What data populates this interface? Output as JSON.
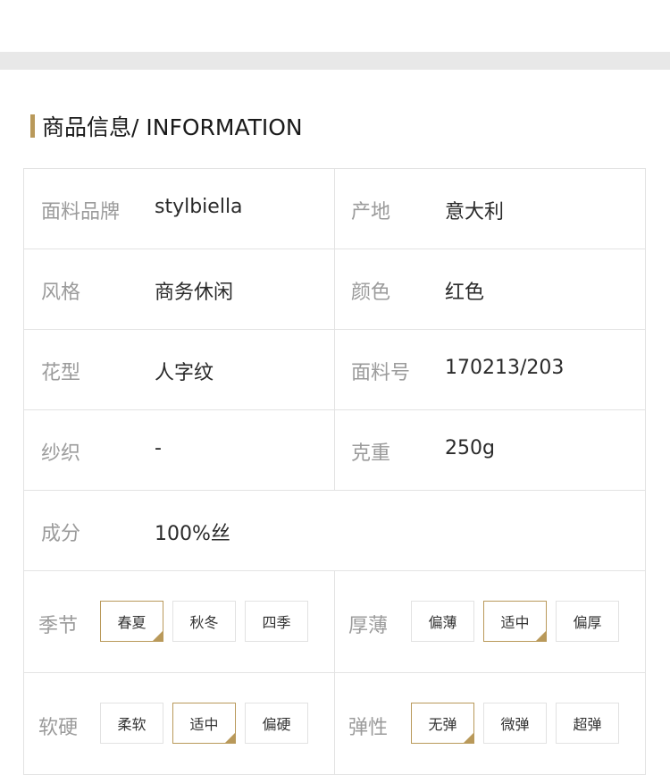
{
  "section_title": "商品信息/ INFORMATION",
  "colors": {
    "accent": "#b9995a",
    "border": "#e3e3e3",
    "label": "#9b9b9b",
    "value": "#2a2a2a"
  },
  "specs": {
    "fabric_brand": {
      "label": "面料品牌",
      "value": "stylbiella"
    },
    "origin": {
      "label": "产地",
      "value": "意大利"
    },
    "style": {
      "label": "风格",
      "value": "商务休闲"
    },
    "color": {
      "label": "颜色",
      "value": "红色"
    },
    "pattern": {
      "label": "花型",
      "value": "人字纹"
    },
    "fabric_no": {
      "label": "面料号",
      "value": "170213/203"
    },
    "yarn": {
      "label": "纱织",
      "value": "-"
    },
    "weight": {
      "label": "克重",
      "value": "250g"
    },
    "composition": {
      "label": "成分",
      "value": "100%丝"
    }
  },
  "attributes": {
    "season": {
      "label": "季节",
      "options": [
        "春夏",
        "秋冬",
        "四季"
      ],
      "selected": "春夏"
    },
    "thickness": {
      "label": "厚薄",
      "options": [
        "偏薄",
        "适中",
        "偏厚"
      ],
      "selected": "适中"
    },
    "hardness": {
      "label": "软硬",
      "options": [
        "柔软",
        "适中",
        "偏硬"
      ],
      "selected": "适中"
    },
    "elasticity": {
      "label": "弹性",
      "options": [
        "无弹",
        "微弹",
        "超弹"
      ],
      "selected": "无弹"
    }
  }
}
